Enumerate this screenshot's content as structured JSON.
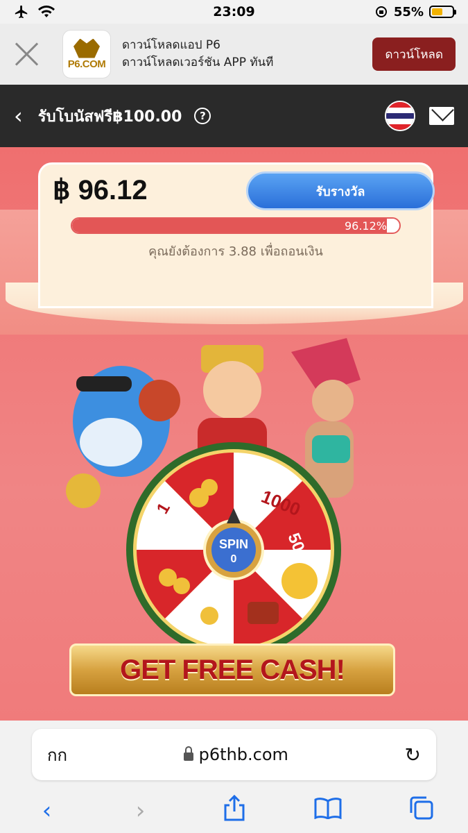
{
  "status_bar": {
    "time": "23:09",
    "battery_text": "55%",
    "battery_level": 0.55
  },
  "banner": {
    "logo_text": "P6.COM",
    "line1": "ดาวน์โหลดแอป P6",
    "line2": "ดาวน์โหลดเวอร์ชัน APP ทันที",
    "download_label": "ดาวน์โหลด"
  },
  "header": {
    "title": "รับโบนัสฟรี฿100.00",
    "help": "?"
  },
  "bonus": {
    "amount": "฿ 96.12",
    "claim_label": "รับรางวัล",
    "progress_percent": 96.12,
    "progress_label": "96.12%",
    "need_text": "คุณยังต้องการ 3.88 เพื่อถอนเงิน"
  },
  "wheel": {
    "spin_label": "SPIN",
    "spin_count": "0",
    "segments": [
      "1000",
      "50",
      "1"
    ]
  },
  "promo": {
    "title": "GET FREE CASH!"
  },
  "browser": {
    "text_size": "กก",
    "host": "p6thb.com"
  },
  "colors": {
    "header_bg": "#2a2a2a",
    "claim_blue": "#2a6fd9",
    "progress_red": "#e35656",
    "download_btn": "#8a1f1f"
  }
}
